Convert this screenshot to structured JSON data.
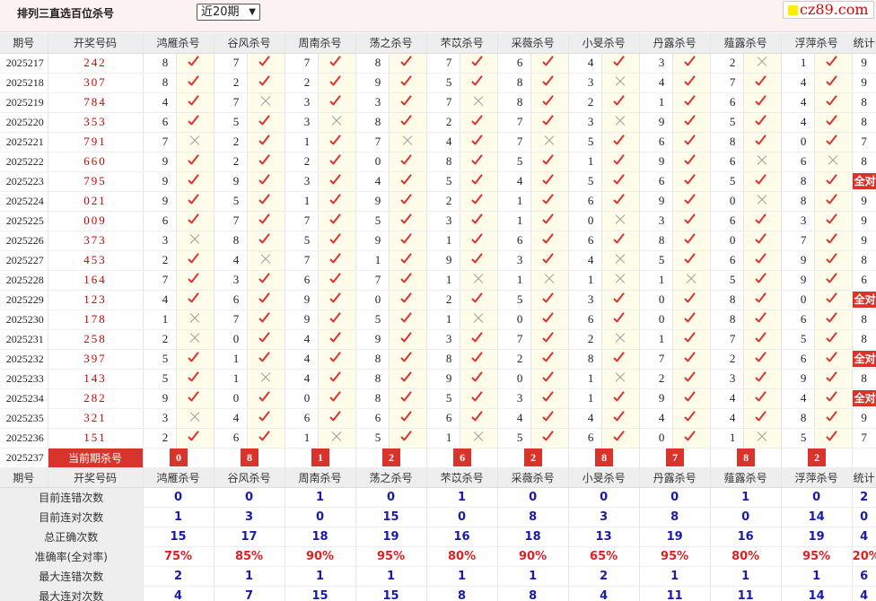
{
  "header": {
    "title": "排列三直选百位杀号",
    "period_select": "近20期",
    "logo": "cz89.com"
  },
  "columns": [
    "期号",
    "开奖号码",
    "鸿雁杀号",
    "谷风杀号",
    "周南杀号",
    "荡之杀号",
    "芣苡杀号",
    "采薇杀号",
    "小旻杀号",
    "丹露杀号",
    "薤露杀号",
    "浮萍杀号",
    "统计"
  ],
  "rows": [
    {
      "issue": "2025217",
      "draw": "242",
      "picks": [
        [
          8,
          1
        ],
        [
          7,
          1
        ],
        [
          7,
          1
        ],
        [
          8,
          1
        ],
        [
          7,
          1
        ],
        [
          6,
          1
        ],
        [
          4,
          1
        ],
        [
          3,
          1
        ],
        [
          2,
          0
        ],
        [
          1,
          1
        ]
      ],
      "count": "9"
    },
    {
      "issue": "2025218",
      "draw": "307",
      "picks": [
        [
          8,
          1
        ],
        [
          2,
          1
        ],
        [
          2,
          1
        ],
        [
          9,
          1
        ],
        [
          5,
          1
        ],
        [
          8,
          1
        ],
        [
          3,
          0
        ],
        [
          4,
          1
        ],
        [
          7,
          1
        ],
        [
          4,
          1
        ]
      ],
      "count": "9"
    },
    {
      "issue": "2025219",
      "draw": "784",
      "picks": [
        [
          4,
          1
        ],
        [
          7,
          0
        ],
        [
          3,
          1
        ],
        [
          3,
          1
        ],
        [
          7,
          0
        ],
        [
          8,
          1
        ],
        [
          2,
          1
        ],
        [
          1,
          1
        ],
        [
          6,
          1
        ],
        [
          4,
          1
        ]
      ],
      "count": "8"
    },
    {
      "issue": "2025220",
      "draw": "353",
      "picks": [
        [
          6,
          1
        ],
        [
          5,
          1
        ],
        [
          3,
          0
        ],
        [
          8,
          1
        ],
        [
          2,
          1
        ],
        [
          7,
          1
        ],
        [
          3,
          0
        ],
        [
          9,
          1
        ],
        [
          5,
          1
        ],
        [
          4,
          1
        ]
      ],
      "count": "8"
    },
    {
      "issue": "2025221",
      "draw": "791",
      "picks": [
        [
          7,
          0
        ],
        [
          2,
          1
        ],
        [
          1,
          1
        ],
        [
          7,
          0
        ],
        [
          4,
          1
        ],
        [
          7,
          0
        ],
        [
          5,
          1
        ],
        [
          6,
          1
        ],
        [
          8,
          1
        ],
        [
          0,
          1
        ]
      ],
      "count": "7"
    },
    {
      "issue": "2025222",
      "draw": "660",
      "picks": [
        [
          9,
          1
        ],
        [
          2,
          1
        ],
        [
          2,
          1
        ],
        [
          0,
          1
        ],
        [
          8,
          1
        ],
        [
          5,
          1
        ],
        [
          1,
          1
        ],
        [
          9,
          1
        ],
        [
          6,
          0
        ],
        [
          6,
          0
        ]
      ],
      "count": "8"
    },
    {
      "issue": "2025223",
      "draw": "795",
      "picks": [
        [
          9,
          1
        ],
        [
          9,
          1
        ],
        [
          3,
          1
        ],
        [
          4,
          1
        ],
        [
          5,
          1
        ],
        [
          4,
          1
        ],
        [
          5,
          1
        ],
        [
          6,
          1
        ],
        [
          5,
          1
        ],
        [
          8,
          1
        ]
      ],
      "count": "全对"
    },
    {
      "issue": "2025224",
      "draw": "021",
      "picks": [
        [
          9,
          1
        ],
        [
          5,
          1
        ],
        [
          1,
          1
        ],
        [
          9,
          1
        ],
        [
          2,
          1
        ],
        [
          1,
          1
        ],
        [
          6,
          1
        ],
        [
          9,
          1
        ],
        [
          0,
          0
        ],
        [
          8,
          1
        ]
      ],
      "count": "9"
    },
    {
      "issue": "2025225",
      "draw": "009",
      "picks": [
        [
          6,
          1
        ],
        [
          7,
          1
        ],
        [
          7,
          1
        ],
        [
          5,
          1
        ],
        [
          3,
          1
        ],
        [
          1,
          1
        ],
        [
          0,
          0
        ],
        [
          3,
          1
        ],
        [
          6,
          1
        ],
        [
          3,
          1
        ]
      ],
      "count": "9"
    },
    {
      "issue": "2025226",
      "draw": "373",
      "picks": [
        [
          3,
          0
        ],
        [
          8,
          1
        ],
        [
          5,
          1
        ],
        [
          9,
          1
        ],
        [
          1,
          1
        ],
        [
          6,
          1
        ],
        [
          6,
          1
        ],
        [
          8,
          1
        ],
        [
          0,
          1
        ],
        [
          7,
          1
        ]
      ],
      "count": "9"
    },
    {
      "issue": "2025227",
      "draw": "453",
      "picks": [
        [
          2,
          1
        ],
        [
          4,
          0
        ],
        [
          7,
          1
        ],
        [
          1,
          1
        ],
        [
          9,
          1
        ],
        [
          3,
          1
        ],
        [
          4,
          0
        ],
        [
          5,
          1
        ],
        [
          6,
          1
        ],
        [
          9,
          1
        ]
      ],
      "count": "8"
    },
    {
      "issue": "2025228",
      "draw": "164",
      "picks": [
        [
          7,
          1
        ],
        [
          3,
          1
        ],
        [
          6,
          1
        ],
        [
          7,
          1
        ],
        [
          1,
          0
        ],
        [
          1,
          0
        ],
        [
          1,
          0
        ],
        [
          1,
          0
        ],
        [
          5,
          1
        ],
        [
          9,
          1
        ]
      ],
      "count": "6"
    },
    {
      "issue": "2025229",
      "draw": "123",
      "picks": [
        [
          4,
          1
        ],
        [
          6,
          1
        ],
        [
          9,
          1
        ],
        [
          0,
          1
        ],
        [
          2,
          1
        ],
        [
          5,
          1
        ],
        [
          3,
          1
        ],
        [
          0,
          1
        ],
        [
          8,
          1
        ],
        [
          0,
          1
        ]
      ],
      "count": "全对"
    },
    {
      "issue": "2025230",
      "draw": "178",
      "picks": [
        [
          1,
          0
        ],
        [
          7,
          1
        ],
        [
          9,
          1
        ],
        [
          5,
          1
        ],
        [
          1,
          0
        ],
        [
          0,
          1
        ],
        [
          6,
          1
        ],
        [
          0,
          1
        ],
        [
          8,
          1
        ],
        [
          6,
          1
        ]
      ],
      "count": "8"
    },
    {
      "issue": "2025231",
      "draw": "258",
      "picks": [
        [
          2,
          0
        ],
        [
          0,
          1
        ],
        [
          4,
          1
        ],
        [
          9,
          1
        ],
        [
          3,
          1
        ],
        [
          7,
          1
        ],
        [
          2,
          0
        ],
        [
          1,
          1
        ],
        [
          7,
          1
        ],
        [
          5,
          1
        ]
      ],
      "count": "8"
    },
    {
      "issue": "2025232",
      "draw": "397",
      "picks": [
        [
          5,
          1
        ],
        [
          1,
          1
        ],
        [
          4,
          1
        ],
        [
          8,
          1
        ],
        [
          8,
          1
        ],
        [
          2,
          1
        ],
        [
          8,
          1
        ],
        [
          7,
          1
        ],
        [
          2,
          1
        ],
        [
          6,
          1
        ]
      ],
      "count": "全对"
    },
    {
      "issue": "2025233",
      "draw": "143",
      "picks": [
        [
          5,
          1
        ],
        [
          1,
          0
        ],
        [
          4,
          1
        ],
        [
          8,
          1
        ],
        [
          9,
          1
        ],
        [
          0,
          1
        ],
        [
          1,
          0
        ],
        [
          2,
          1
        ],
        [
          3,
          1
        ],
        [
          9,
          1
        ]
      ],
      "count": "8"
    },
    {
      "issue": "2025234",
      "draw": "282",
      "picks": [
        [
          9,
          1
        ],
        [
          0,
          1
        ],
        [
          0,
          1
        ],
        [
          8,
          1
        ],
        [
          5,
          1
        ],
        [
          3,
          1
        ],
        [
          1,
          1
        ],
        [
          9,
          1
        ],
        [
          4,
          1
        ],
        [
          4,
          1
        ]
      ],
      "count": "全对"
    },
    {
      "issue": "2025235",
      "draw": "321",
      "picks": [
        [
          3,
          0
        ],
        [
          4,
          1
        ],
        [
          6,
          1
        ],
        [
          6,
          1
        ],
        [
          6,
          1
        ],
        [
          4,
          1
        ],
        [
          4,
          1
        ],
        [
          4,
          1
        ],
        [
          4,
          1
        ],
        [
          8,
          1
        ]
      ],
      "count": "9"
    },
    {
      "issue": "2025236",
      "draw": "151",
      "picks": [
        [
          2,
          1
        ],
        [
          6,
          1
        ],
        [
          1,
          0
        ],
        [
          5,
          1
        ],
        [
          1,
          0
        ],
        [
          5,
          1
        ],
        [
          6,
          1
        ],
        [
          0,
          1
        ],
        [
          1,
          0
        ],
        [
          5,
          1
        ]
      ],
      "count": "7"
    }
  ],
  "current": {
    "issue": "2025237",
    "label": "当前期杀号",
    "values": [
      "0",
      "8",
      "1",
      "2",
      "6",
      "2",
      "8",
      "7",
      "8",
      "2"
    ]
  },
  "stats": [
    {
      "label": "目前连错次数",
      "values": [
        "0",
        "0",
        "1",
        "0",
        "1",
        "0",
        "0",
        "0",
        "1",
        "0"
      ],
      "total": "2",
      "red": false
    },
    {
      "label": "目前连对次数",
      "values": [
        "1",
        "3",
        "0",
        "15",
        "0",
        "8",
        "3",
        "8",
        "0",
        "14"
      ],
      "total": "0",
      "red": false
    },
    {
      "label": "总正确次数",
      "values": [
        "15",
        "17",
        "18",
        "19",
        "16",
        "18",
        "13",
        "19",
        "16",
        "19"
      ],
      "total": "4",
      "red": false
    },
    {
      "label": "准确率(全对率)",
      "values": [
        "75%",
        "85%",
        "90%",
        "95%",
        "80%",
        "90%",
        "65%",
        "95%",
        "80%",
        "95%"
      ],
      "total": "20%",
      "red": true
    },
    {
      "label": "最大连错次数",
      "values": [
        "2",
        "1",
        "1",
        "1",
        "1",
        "1",
        "2",
        "1",
        "1",
        "1"
      ],
      "total": "6",
      "red": false
    },
    {
      "label": "最大连对次数",
      "values": [
        "4",
        "7",
        "15",
        "15",
        "8",
        "8",
        "4",
        "11",
        "11",
        "14"
      ],
      "total": "4",
      "red": false
    }
  ],
  "colors": {
    "accent_red": "#d9342b",
    "check_red": "#e03030",
    "stat_blue": "#1a1aa8"
  }
}
